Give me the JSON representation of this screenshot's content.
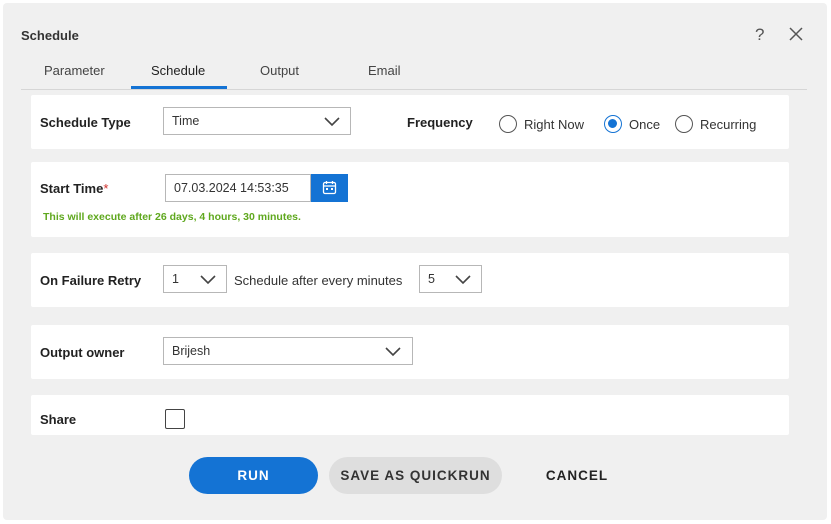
{
  "dialog": {
    "title": "Schedule",
    "help_glyph": "?"
  },
  "tabs": [
    {
      "label": "Parameter"
    },
    {
      "label": "Schedule",
      "active": true
    },
    {
      "label": "Output"
    },
    {
      "label": "Email"
    }
  ],
  "schedule_type": {
    "label": "Schedule Type",
    "value": "Time"
  },
  "frequency": {
    "label": "Frequency",
    "options": [
      "Right Now",
      "Once",
      "Recurring"
    ],
    "selected": "Once"
  },
  "start_time": {
    "label": "Start Time",
    "required_mark": "*",
    "value": "07.03.2024 14:53:35",
    "hint": "This will execute after 26 days, 4 hours, 30 minutes."
  },
  "failure_retry": {
    "label": "On Failure Retry",
    "value": "1",
    "interval_label": "Schedule after every minutes",
    "interval_value": "5"
  },
  "output_owner": {
    "label": "Output owner",
    "value": "Brijesh"
  },
  "share": {
    "label": "Share",
    "checked": false
  },
  "actions": {
    "run": "RUN",
    "save_quickrun": "SAVE AS QUICKRUN",
    "cancel": "CANCEL"
  },
  "colors": {
    "accent": "#1473d4",
    "hint": "#5fa81e",
    "background": "#f0f0f0",
    "card": "#ffffff",
    "required": "#d0312d"
  },
  "icons": {
    "help": "help-icon",
    "close": "close-icon",
    "dropdown": "chevron-down-icon",
    "calendar": "calendar-icon"
  }
}
